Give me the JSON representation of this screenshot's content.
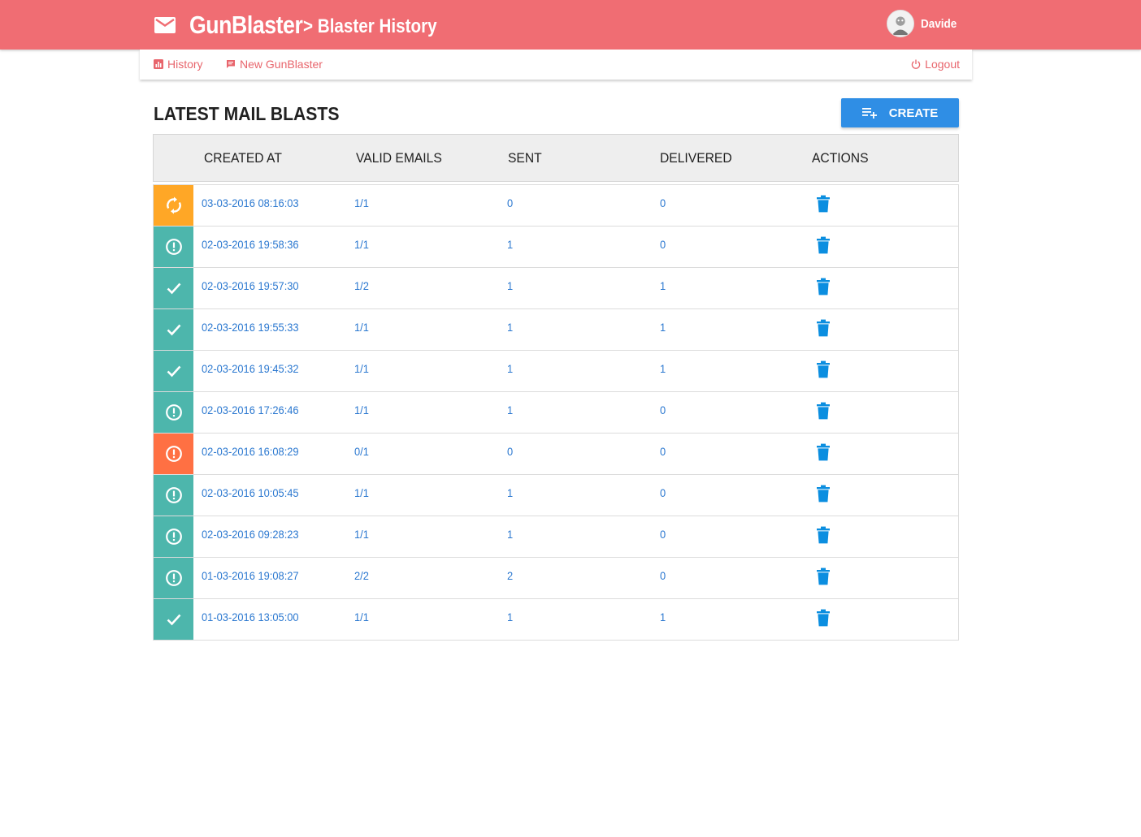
{
  "header": {
    "brand": "GunBlaster",
    "subtitle": "> Blaster History",
    "user_name": "Davide",
    "bg_color": "#f06d73"
  },
  "nav": {
    "history_label": "History",
    "new_label": "New GunBlaster",
    "logout_label": "Logout"
  },
  "main": {
    "title": "LATEST MAIL BLASTS",
    "create_label": "CREATE"
  },
  "table": {
    "columns": [
      "CREATED AT",
      "VALID EMAILS",
      "SENT",
      "DELIVERED",
      "ACTIONS"
    ],
    "rows": [
      {
        "status": "syncing",
        "color": "#ffa726",
        "created_at": "03-03-2016 08:16:03",
        "valid": "1/1",
        "sent": "0",
        "delivered": "0"
      },
      {
        "status": "warning",
        "color": "#4db6ac",
        "created_at": "02-03-2016 19:58:36",
        "valid": "1/1",
        "sent": "1",
        "delivered": "0"
      },
      {
        "status": "done",
        "color": "#4db6ac",
        "created_at": "02-03-2016 19:57:30",
        "valid": "1/2",
        "sent": "1",
        "delivered": "1"
      },
      {
        "status": "done",
        "color": "#4db6ac",
        "created_at": "02-03-2016 19:55:33",
        "valid": "1/1",
        "sent": "1",
        "delivered": "1"
      },
      {
        "status": "done",
        "color": "#4db6ac",
        "created_at": "02-03-2016 19:45:32",
        "valid": "1/1",
        "sent": "1",
        "delivered": "1"
      },
      {
        "status": "warning",
        "color": "#4db6ac",
        "created_at": "02-03-2016 17:26:46",
        "valid": "1/1",
        "sent": "1",
        "delivered": "0"
      },
      {
        "status": "error",
        "color": "#ff7043",
        "created_at": "02-03-2016 16:08:29",
        "valid": "0/1",
        "sent": "0",
        "delivered": "0"
      },
      {
        "status": "warning",
        "color": "#4db6ac",
        "created_at": "02-03-2016 10:05:45",
        "valid": "1/1",
        "sent": "1",
        "delivered": "0"
      },
      {
        "status": "warning",
        "color": "#4db6ac",
        "created_at": "02-03-2016 09:28:23",
        "valid": "1/1",
        "sent": "1",
        "delivered": "0"
      },
      {
        "status": "warning",
        "color": "#4db6ac",
        "created_at": "01-03-2016 19:08:27",
        "valid": "2/2",
        "sent": "2",
        "delivered": "0"
      },
      {
        "status": "done",
        "color": "#4db6ac",
        "created_at": "01-03-2016 13:05:00",
        "valid": "1/1",
        "sent": "1",
        "delivered": "1"
      }
    ]
  },
  "colors": {
    "accent": "#2f8ee5",
    "link": "#2b78d0",
    "trash": "#0b8ee0",
    "nav_link": "#e8656c"
  }
}
